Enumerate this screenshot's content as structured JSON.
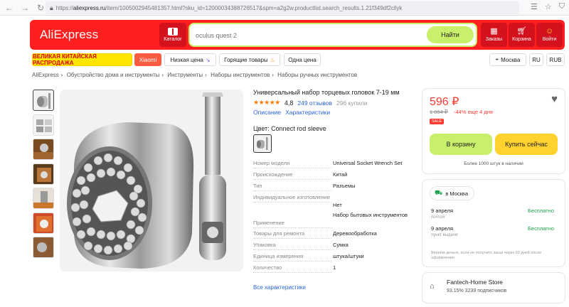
{
  "browser": {
    "url_host": "aliexpress.ru",
    "url_path": "/item/1005002945481357.html?sku_id=12000034388726517&spm=a2g2w.productlist.search_results.1.21f349df2cllyk",
    "url_scheme": "https://"
  },
  "header": {
    "logo": "AliExpress",
    "catalog_label": "Каталог",
    "search_placeholder": "oculus quest 2",
    "search_button": "Найти",
    "icons": [
      {
        "label": "Заказы",
        "icon": "box-icon"
      },
      {
        "label": "Корзина",
        "icon": "cart-icon"
      },
      {
        "label": "Войти",
        "icon": "smile-icon"
      }
    ]
  },
  "promo": {
    "items": [
      "ВЕЛИКАЯ КИТАЙСКАЯ РАСПРОДАЖА",
      "Xiaomi",
      "Низкая цена",
      "Горящие товары",
      "Одна цена"
    ],
    "location": "Москва",
    "lang": "RU",
    "currency": "RUB"
  },
  "breadcrumbs": [
    "AliExpress",
    "Обустройство дома и инструменты",
    "Инструменты",
    "Наборы инструментов",
    "Наборы ручных инструментов"
  ],
  "product": {
    "title": "Универсальный набор торцевых головок 7-19 мм",
    "stars": "★★★★★",
    "rating": "4,8",
    "reviews": "249 отзывов",
    "bought": "296 купили",
    "tab_description": "Описание",
    "tab_specs": "Характеристики",
    "color_label": "Цвет: Connect rod sleeve",
    "specs": [
      {
        "k": "Номер модели",
        "v": "Universal Socket Wrench Set"
      },
      {
        "k": "Происхождение",
        "v": "Китай"
      },
      {
        "k": "Тип",
        "v": "Разъемы"
      },
      {
        "k": "Индивидуальное изготовление",
        "v": "Нет"
      },
      {
        "k": "Применение",
        "v": "Набор бытовых инструментов"
      },
      {
        "k": "Товары для ремонта",
        "v": "Деревообработка"
      },
      {
        "k": "Упаковка",
        "v": "Сумка"
      },
      {
        "k": "Единица измерения",
        "v": "штука/штуки"
      },
      {
        "k": "Количество",
        "v": "1"
      }
    ],
    "all_specs": "Все характеристики"
  },
  "buy": {
    "price": "596 ₽",
    "old_price": "1 064 ₽",
    "discount": "-44% еще 4 дня",
    "sale": "SALE",
    "cart_button": "В корзину",
    "buy_button": "Купить сейчас",
    "stock": "Более 1000 штук в наличии"
  },
  "delivery": {
    "city": "в Москва",
    "rows": [
      {
        "date": "9 апреля",
        "sub": "почтой",
        "price": "Бесплатно"
      },
      {
        "date": "9 апреля",
        "sub": "пункт выдачи",
        "price": "Бесплатно"
      }
    ],
    "refund": "Вернём деньги, если не получите заказ через 60 дней после оформления"
  },
  "store": {
    "name": "Fantech-Home Store",
    "stats": "93.15%  3239 подписчиков"
  },
  "colors": {
    "brand_red": "#ff1f1f",
    "accent_green": "#c8f06a",
    "accent_yellow": "#ffd22e",
    "link_blue": "#2a64d8"
  }
}
